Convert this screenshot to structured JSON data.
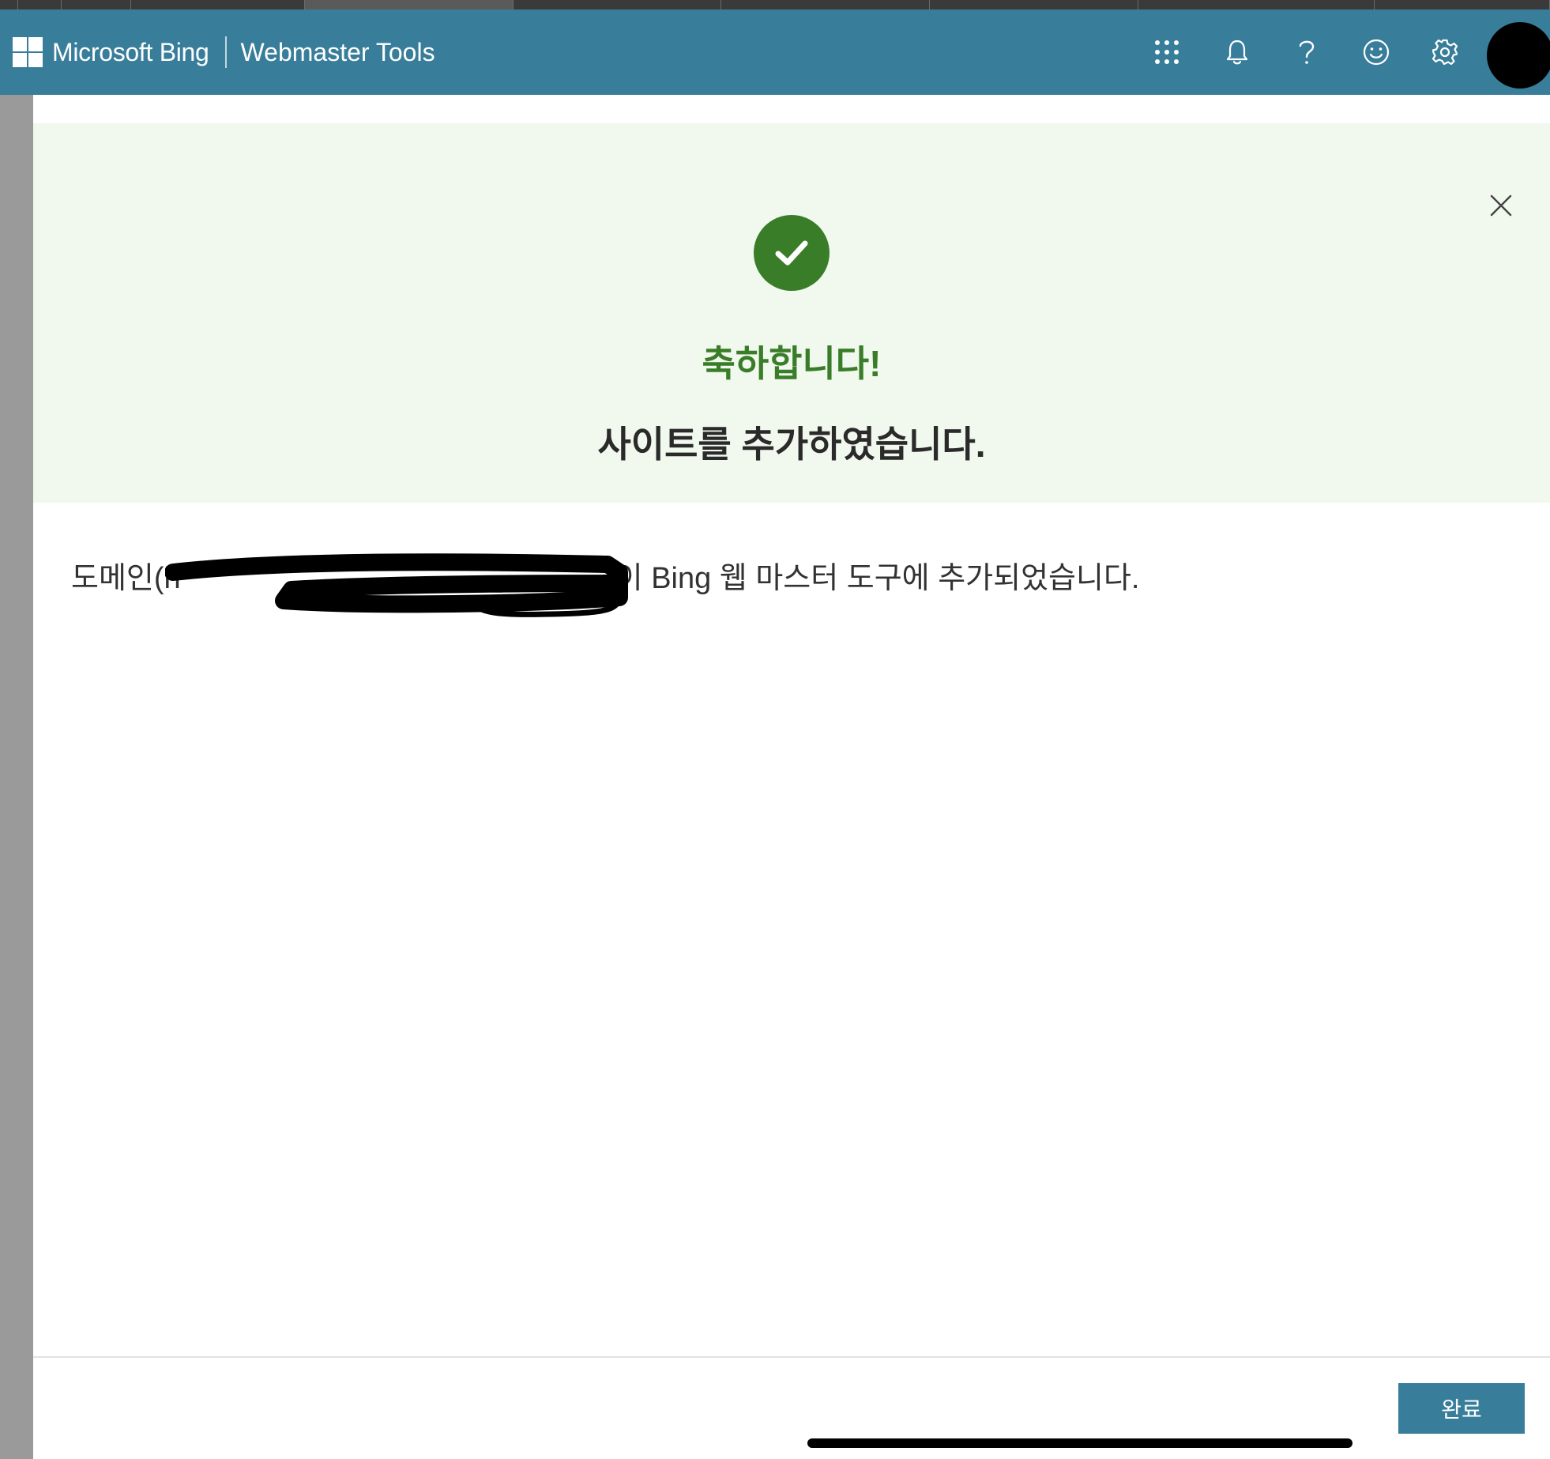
{
  "header": {
    "brand": "Microsoft Bing",
    "product": "Webmaster Tools",
    "icons": [
      "apps-grid-icon",
      "bell-icon",
      "help-icon",
      "feedback-smiley-icon",
      "gear-icon"
    ]
  },
  "dialog": {
    "congrats": "축하합니다!",
    "title": "사이트를 추가하였습니다.",
    "message_prefix": "도메인(h",
    "message_suffix": "이 Bing 웹 마스터 도구에 추가되었습니다.",
    "done_label": "완료"
  },
  "colors": {
    "header": "#387e9b",
    "banner": "#f1f8ee",
    "success": "#3a7d28",
    "button": "#387e9b"
  }
}
